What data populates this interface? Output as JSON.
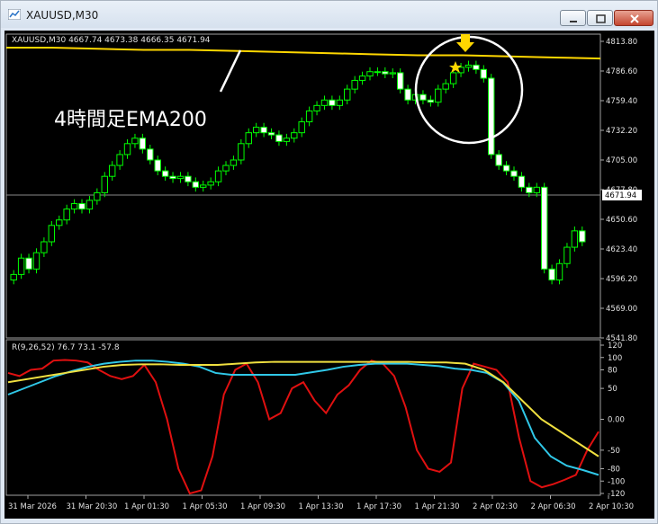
{
  "window": {
    "title": "XAUUSD,M30",
    "controls": [
      "minimize",
      "maximize",
      "close"
    ]
  },
  "header_info": "XAUUSD,M30  4667.74 4673.38 4666.35 4671.94",
  "annotation": {
    "text": "4時間足EMA200",
    "marker_icons": [
      "down-arrow-icon",
      "star-icon"
    ]
  },
  "price_axis": {
    "labels": [
      "4813.80",
      "4786.60",
      "4759.40",
      "4732.20",
      "4705.00",
      "4677.80",
      "4650.60",
      "4623.40",
      "4596.20",
      "4569.00",
      "4541.80"
    ],
    "current_price": "4671.94"
  },
  "indicator": {
    "header": "R(9,26,52) 76.7 73.1 -57.8",
    "axis_labels": [
      "120",
      "100",
      "80",
      "50",
      "0.00",
      "-50",
      "-80",
      "-100",
      "-120"
    ]
  },
  "time_axis": {
    "labels": [
      "31 Mar 2026",
      "31 Mar 20:30",
      "1 Apr 01:30",
      "1 Apr 05:30",
      "1 Apr 09:30",
      "1 Apr 13:30",
      "1 Apr 17:30",
      "1 Apr 21:30",
      "2 Apr 02:30",
      "2 Apr 06:30",
      "2 Apr 10:30"
    ]
  },
  "chart_data": {
    "type": "candlestick",
    "symbol": "XAUUSD",
    "timeframe": "M30",
    "ylim": [
      4541.8,
      4813.8
    ],
    "candles_close": [
      4600,
      4615,
      4605,
      4620,
      4630,
      4645,
      4650,
      4660,
      4665,
      4660,
      4668,
      4675,
      4690,
      4700,
      4710,
      4720,
      4725,
      4715,
      4705,
      4695,
      4690,
      4688,
      4690,
      4685,
      4680,
      4682,
      4685,
      4695,
      4700,
      4705,
      4720,
      4730,
      4735,
      4730,
      4728,
      4722,
      4725,
      4730,
      4740,
      4750,
      4755,
      4760,
      4755,
      4760,
      4770,
      4778,
      4782,
      4786,
      4786,
      4784,
      4785,
      4770,
      4760,
      4765,
      4760,
      4758,
      4770,
      4775,
      4785,
      4790,
      4792,
      4788,
      4780,
      4710,
      4700,
      4695,
      4690,
      4680,
      4675,
      4680,
      4605,
      4595,
      4610,
      4625,
      4640,
      4630
    ],
    "ema200_4h": [
      4808,
      4808,
      4807,
      4806,
      4806,
      4805,
      4804,
      4803,
      4802,
      4801,
      4801,
      4800,
      4799,
      4798
    ],
    "indicator": {
      "name": "R(9,26,52)",
      "values": {
        "fast": 76.7,
        "mid": 73.1,
        "slow": -57.8
      },
      "ylim": [
        -120,
        120
      ],
      "series": [
        {
          "color": "#e01010",
          "values": [
            75,
            70,
            80,
            82,
            95,
            96,
            95,
            92,
            80,
            70,
            65,
            70,
            88,
            60,
            0,
            -80,
            -120,
            -115,
            -60,
            40,
            80,
            90,
            60,
            0,
            10,
            50,
            60,
            30,
            10,
            40,
            55,
            80,
            95,
            90,
            70,
            20,
            -50,
            -80,
            -85,
            -70,
            50,
            90,
            85,
            80,
            60,
            -30,
            -100,
            -110,
            -105,
            -98,
            -90,
            -50,
            -20
          ]
        },
        {
          "color": "#30c8e8",
          "values": [
            40,
            50,
            60,
            70,
            78,
            85,
            90,
            93,
            95,
            95,
            93,
            90,
            85,
            75,
            72,
            72,
            72,
            72,
            72,
            76,
            80,
            85,
            88,
            90,
            90,
            90,
            88,
            86,
            82,
            80,
            75,
            60,
            30,
            -30,
            -60,
            -75,
            -82,
            -90
          ]
        },
        {
          "color": "#f0e040",
          "values": [
            60,
            65,
            70,
            75,
            80,
            85,
            88,
            89,
            89,
            88,
            88,
            88,
            90,
            92,
            93,
            93,
            93,
            93,
            93,
            93,
            93,
            93,
            92,
            92,
            90,
            80,
            60,
            30,
            0,
            -20,
            -40,
            -60
          ]
        }
      ]
    }
  },
  "colors": {
    "background": "#000000",
    "candle": "#00ff00",
    "grid": "#888888",
    "ema": "#ffd700",
    "marker": "#ffd700",
    "annotation": "#ffffff"
  }
}
